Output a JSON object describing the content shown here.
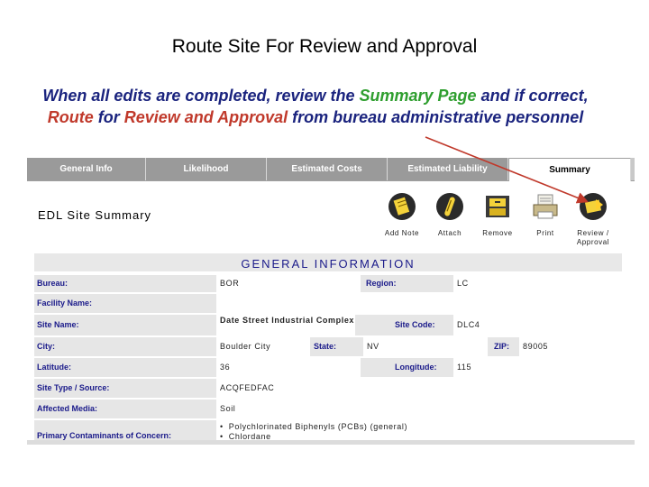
{
  "slide": {
    "title": "Route Site For Review and Approval",
    "instruction": {
      "p1": "When all edits are completed, review the ",
      "summary_page": "Summary Page",
      "p2": " and if correct, ",
      "route": "Route",
      "p3": " for ",
      "review_approval": "Review and Approval",
      "p4": " from bureau administrative personnel"
    },
    "colors": {
      "navy": "#1a237e",
      "green": "#2e9e2e",
      "red": "#c0392b"
    }
  },
  "tabs": [
    {
      "label": "General Info"
    },
    {
      "label": "Likelihood"
    },
    {
      "label": "Estimated Costs"
    },
    {
      "label": "Estimated Liability"
    },
    {
      "label": "Summary"
    }
  ],
  "active_tab": "Summary",
  "page_title": "EDL Site Summary",
  "toolbar": [
    {
      "label": "Add Note",
      "icon": "notepad-icon"
    },
    {
      "label": "Attach",
      "icon": "paperclip-icon"
    },
    {
      "label": "Remove",
      "icon": "file-cabinet-icon"
    },
    {
      "label": "Print",
      "icon": "printer-icon"
    },
    {
      "label": "Review / Approval",
      "icon": "review-approval-icon"
    }
  ],
  "section_header": "GENERAL INFORMATION",
  "fields": {
    "bureau": {
      "label": "Bureau:",
      "value": "BOR"
    },
    "region": {
      "label": "Region:",
      "value": "LC"
    },
    "facility_name": {
      "label": "Facility Name:",
      "value": ""
    },
    "site_name": {
      "label": "Site Name:",
      "value": "Date Street Industrial Complex"
    },
    "site_code": {
      "label": "Site Code:",
      "value": "DLC4"
    },
    "city": {
      "label": "City:",
      "value": "Boulder City"
    },
    "state": {
      "label": "State:",
      "value": "NV"
    },
    "zip": {
      "label": "ZIP:",
      "value": "89005"
    },
    "latitude": {
      "label": "Latitude:",
      "value": "36"
    },
    "longitude": {
      "label": "Longitude:",
      "value": "115"
    },
    "site_type": {
      "label": "Site Type / Source:",
      "value": "ACQFEDFAC"
    },
    "affected_media": {
      "label": "Affected Media:",
      "value": "Soil"
    },
    "contaminants": {
      "label": "Primary Contaminants of Concern:",
      "items": [
        "Polychlorinated Biphenyls (PCBs) (general)",
        "Chlordane"
      ]
    }
  }
}
